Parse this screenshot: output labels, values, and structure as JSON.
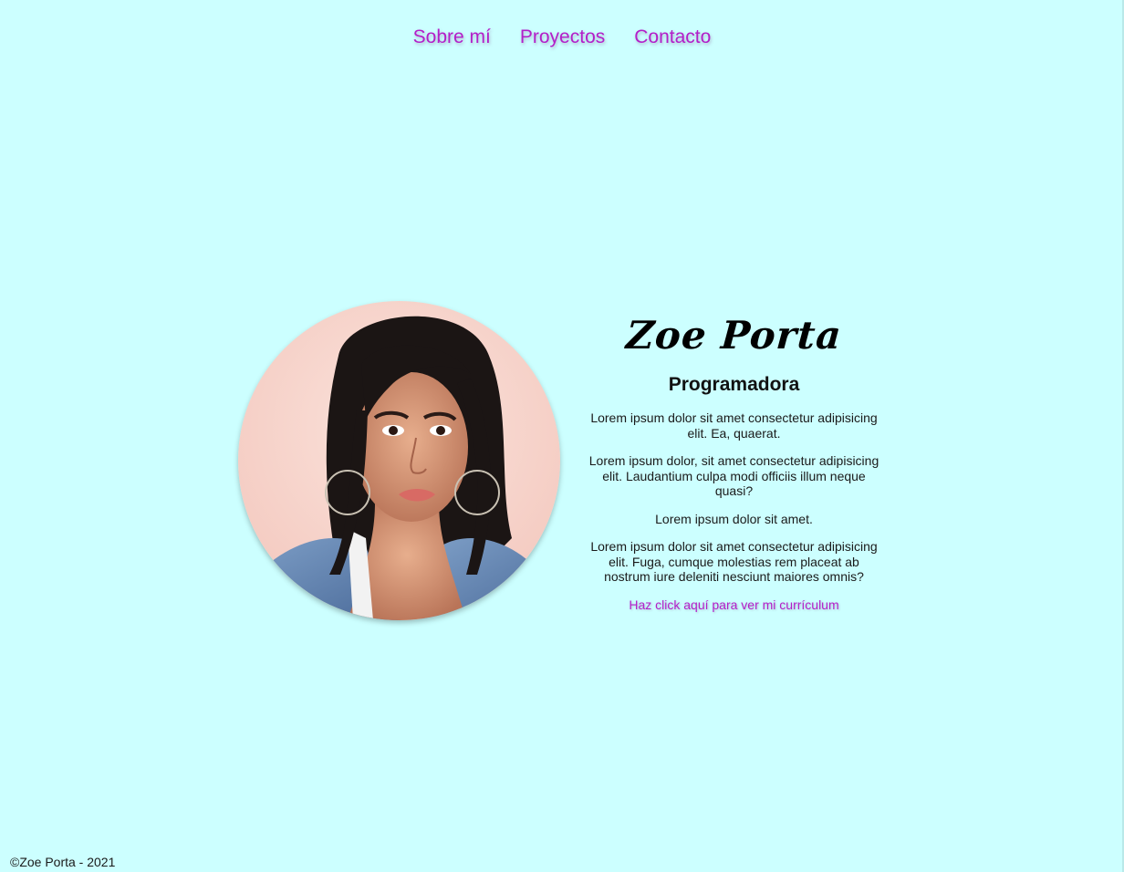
{
  "nav": {
    "items": [
      {
        "label": "Sobre mí"
      },
      {
        "label": "Proyectos"
      },
      {
        "label": "Contacto"
      }
    ]
  },
  "profile": {
    "name": "Zoe Porta",
    "role": "Programadora",
    "paragraphs": [
      "Lorem ipsum dolor sit amet consectetur adipisicing elit. Ea, quaerat.",
      "Lorem ipsum dolor, sit amet consectetur adipisicing elit. Laudantium culpa modi officiis illum neque quasi?",
      "Lorem ipsum dolor sit amet.",
      "Lorem ipsum dolor sit amet consectetur adipisicing elit. Fuga, cumque molestias rem placeat ab nostrum iure deleniti nesciunt maiores omnis?"
    ],
    "cv_link": "Haz click aquí para ver mi currículum"
  },
  "footer": {
    "text": "©Zoe Porta - 2021"
  },
  "colors": {
    "background": "#ccffff",
    "accent": "#b31fc9",
    "text": "#1a1a1a"
  }
}
